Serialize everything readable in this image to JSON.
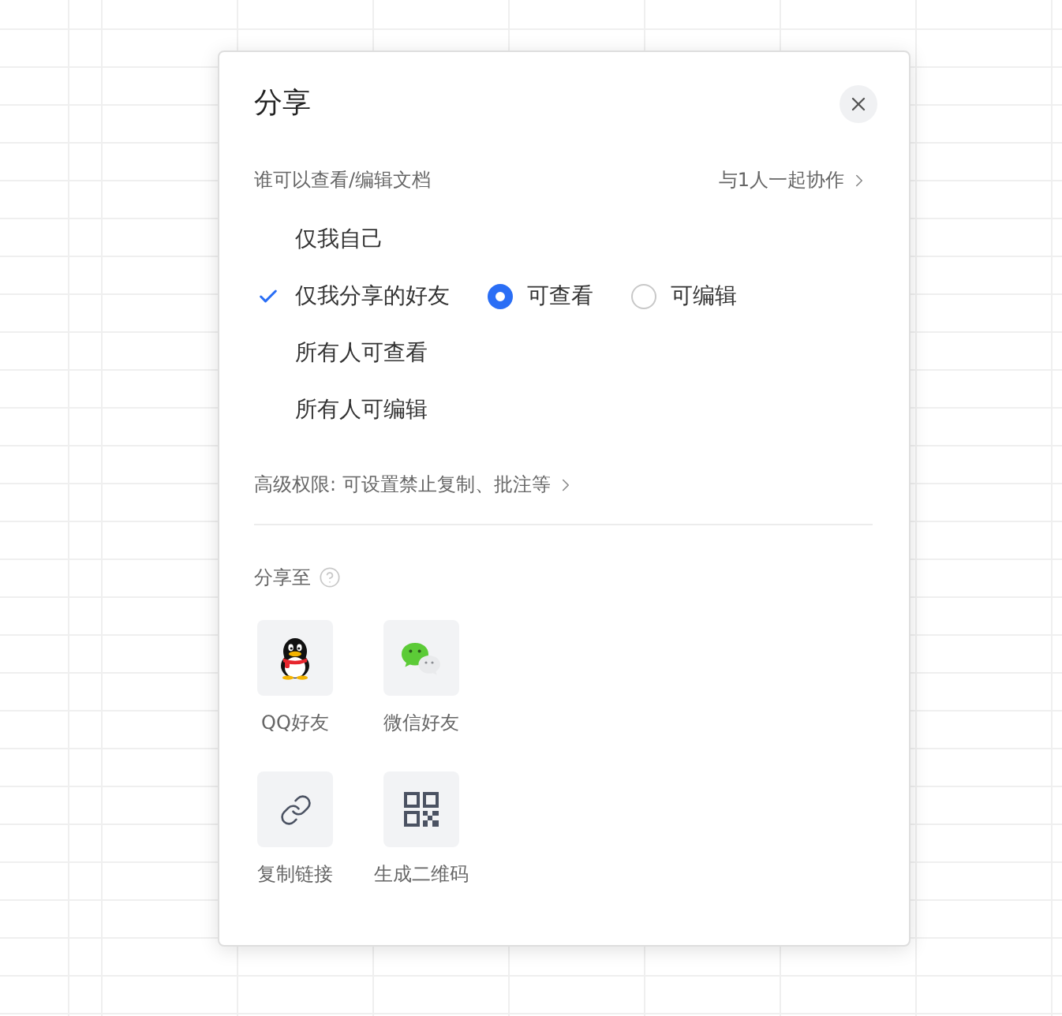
{
  "dialog": {
    "title": "分享"
  },
  "permission": {
    "heading": "谁可以查看/编辑文档",
    "collaborate_link": "与1人一起协作"
  },
  "options": [
    {
      "label": "仅我自己",
      "selected": false
    },
    {
      "label": "仅我分享的好友",
      "selected": true,
      "access": [
        {
          "label": "可查看",
          "selected": true
        },
        {
          "label": "可编辑",
          "selected": false
        }
      ]
    },
    {
      "label": "所有人可查看",
      "selected": false
    },
    {
      "label": "所有人可编辑",
      "selected": false
    }
  ],
  "advanced_link": "高级权限: 可设置禁止复制、批注等",
  "share_to": {
    "heading": "分享至",
    "targets": [
      {
        "kind": "qq",
        "label": "QQ好友"
      },
      {
        "kind": "wechat",
        "label": "微信好友"
      },
      {
        "kind": "link",
        "label": "复制链接"
      },
      {
        "kind": "qrcode",
        "label": "生成二维码"
      }
    ]
  }
}
